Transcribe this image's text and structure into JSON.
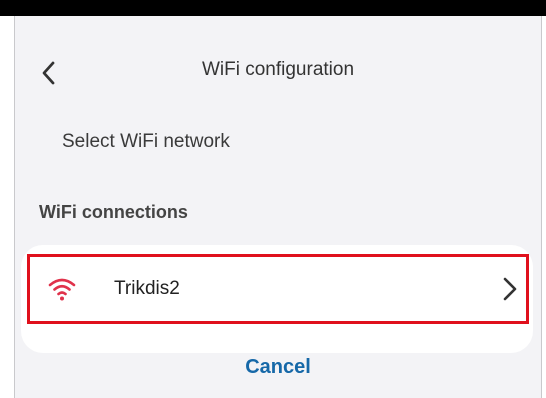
{
  "header": {
    "title": "WiFi configuration",
    "back_icon": "chevron-left-icon"
  },
  "subtitle": "Select WiFi network",
  "section": {
    "heading": "WiFi connections"
  },
  "networks": [
    {
      "name": "Trikdis2",
      "icon": "wifi-signal-icon",
      "icon_color": "#e0324b",
      "highlight_color": "#e0101c",
      "chevron_icon": "chevron-right-icon"
    }
  ],
  "actions": {
    "cancel_label": "Cancel",
    "cancel_color": "#1668a8"
  }
}
